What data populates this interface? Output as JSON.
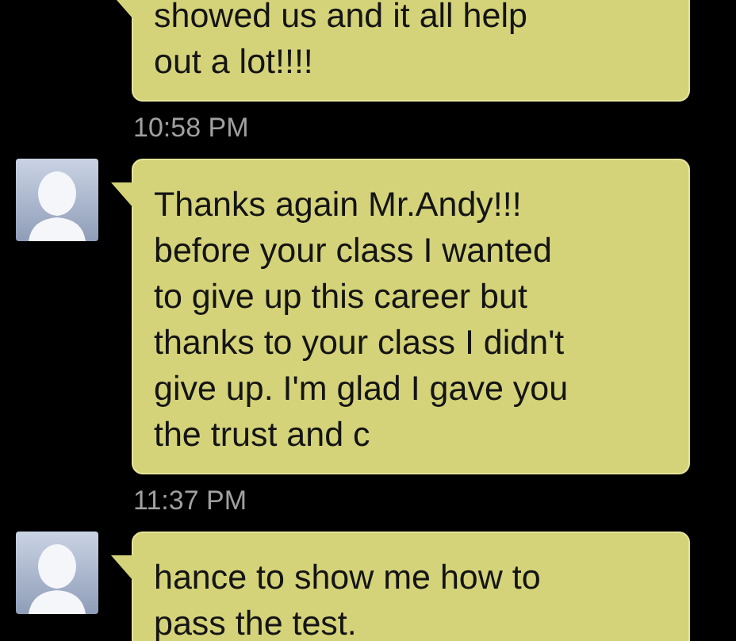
{
  "messages": [
    {
      "avatar": false,
      "text": "showed us and it all help\nout a lot!!!!",
      "time": "10:58 PM"
    },
    {
      "avatar": true,
      "text": "Thanks again Mr.Andy!!!\nbefore your class I wanted\nto give up this career but\nthanks to your class I didn't\ngive up. I'm glad I gave you\nthe trust and c",
      "time": "11:37 PM"
    },
    {
      "avatar": true,
      "text": "hance to show me how to\npass the test."
    }
  ]
}
